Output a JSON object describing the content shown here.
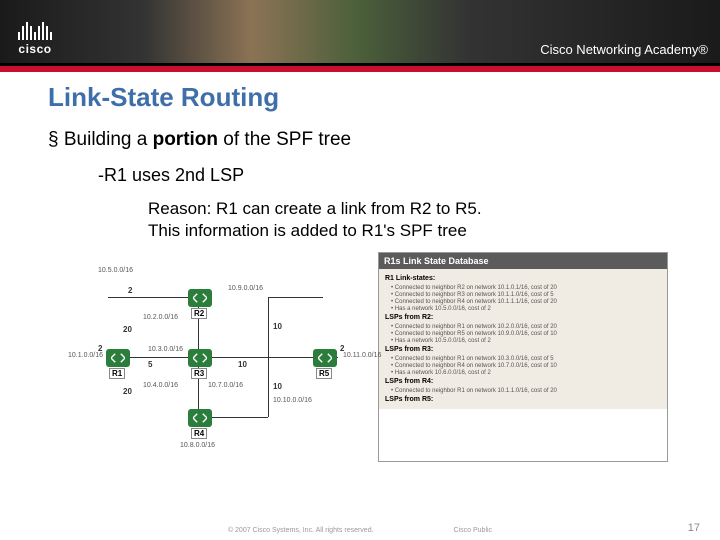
{
  "branding": {
    "logo_text": "cisco",
    "academy_text": "Cisco Networking Academy®"
  },
  "slide": {
    "title": "Link-State Routing",
    "bullet1_pre": "Building a ",
    "bullet1_bold": "portion",
    "bullet1_post": " of the SPF tree",
    "bullet2": "-R1 uses 2nd LSP",
    "reason_line1": "Reason:  R1 can create a link from R2 to R5.",
    "reason_line2": "This information is added to R1's SPF tree"
  },
  "topology": {
    "nets": {
      "n1": "10.5.0.0/16",
      "n2": "10.1.0.0/16",
      "n3": "10.2.0.0/16",
      "n4": "10.9.0.0/16",
      "n5": "10.11.0.0/16",
      "n6": "10.3.0.0/16",
      "n7": "10.4.0.0/16",
      "n8": "10.7.0.0/16",
      "n9": "10.10.0.0/16",
      "n10": "10.8.0.0/16"
    },
    "routers": {
      "r1": "R1",
      "r2": "R2",
      "r3": "R3",
      "r4": "R4",
      "r5": "R5"
    },
    "costs": {
      "c2a": "2",
      "c2b": "2",
      "c20a": "20",
      "c20b": "20",
      "c5": "5",
      "c10a": "10",
      "c10b": "10",
      "c10c": "10",
      "c2c": "2"
    }
  },
  "database": {
    "header": "R1s Link State Database",
    "s1": "R1 Link-states:",
    "s1_items": [
      "Connected to neighbor R2 on network 10.1.0.1/16, cost of 20",
      "Connected to neighbor R3 on network 10.1.1.0/16, cost of 5",
      "Connected to neighbor R4 on network 10.1.1.1/16, cost of 20",
      "Has a network 10.5.0.0/16, cost of 2"
    ],
    "s2": "LSPs from R2:",
    "s2_items": [
      "Connected to neighbor R1 on network 10.2.0.0/16, cost of 20",
      "Connected to neighbor R5 on network 10.9.0.0/16, cost of 10",
      "Has a network 10.5.0.0/16, cost of 2"
    ],
    "s3": "LSPs from R3:",
    "s3_items": [
      "Connected to neighbor R1 on network 10.3.0.0/16, cost of 5",
      "Connected to neighbor R4 on network 10.7.0.0/16, cost of 10",
      "Has a network 10.6.0.0/16, cost of 2"
    ],
    "s4": "LSPs from R4:",
    "s4_items": [
      "Connected to neighbor R1 on network 10.1.1.0/16, cost of 20"
    ],
    "s5": "LSPs from R5:"
  },
  "footer": {
    "copyright": "© 2007 Cisco Systems, Inc. All rights reserved.",
    "label": "Cisco Public",
    "page": "17"
  }
}
